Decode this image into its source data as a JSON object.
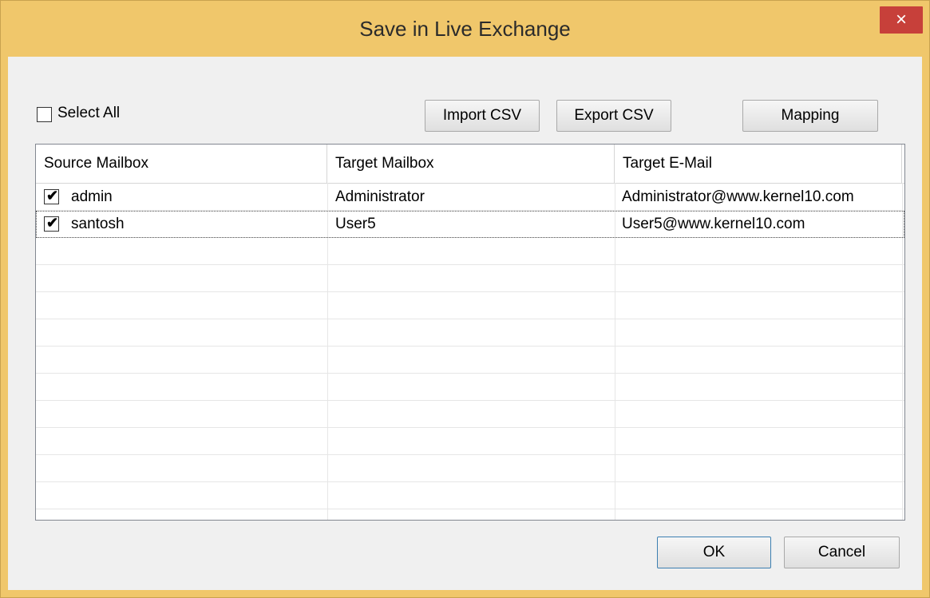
{
  "window": {
    "title": "Save in Live Exchange",
    "close_glyph": "×"
  },
  "toolbar": {
    "select_all_label": "Select All",
    "select_all_checked": false,
    "import_csv": "Import CSV",
    "export_csv": "Export CSV",
    "mapping": "Mapping"
  },
  "table": {
    "columns": [
      "Source Mailbox",
      "Target Mailbox",
      "Target E-Mail"
    ],
    "rows": [
      {
        "checked": true,
        "source": "admin",
        "target": "Administrator",
        "email": "Administrator@www.kernel10.com"
      },
      {
        "checked": true,
        "source": "santosh",
        "target": "User5",
        "email": "User5@www.kernel10.com"
      }
    ]
  },
  "footer": {
    "ok": "OK",
    "cancel": "Cancel"
  },
  "colors": {
    "frame": "#f0c76b",
    "close": "#c7403a",
    "client": "#f0f0f0"
  }
}
